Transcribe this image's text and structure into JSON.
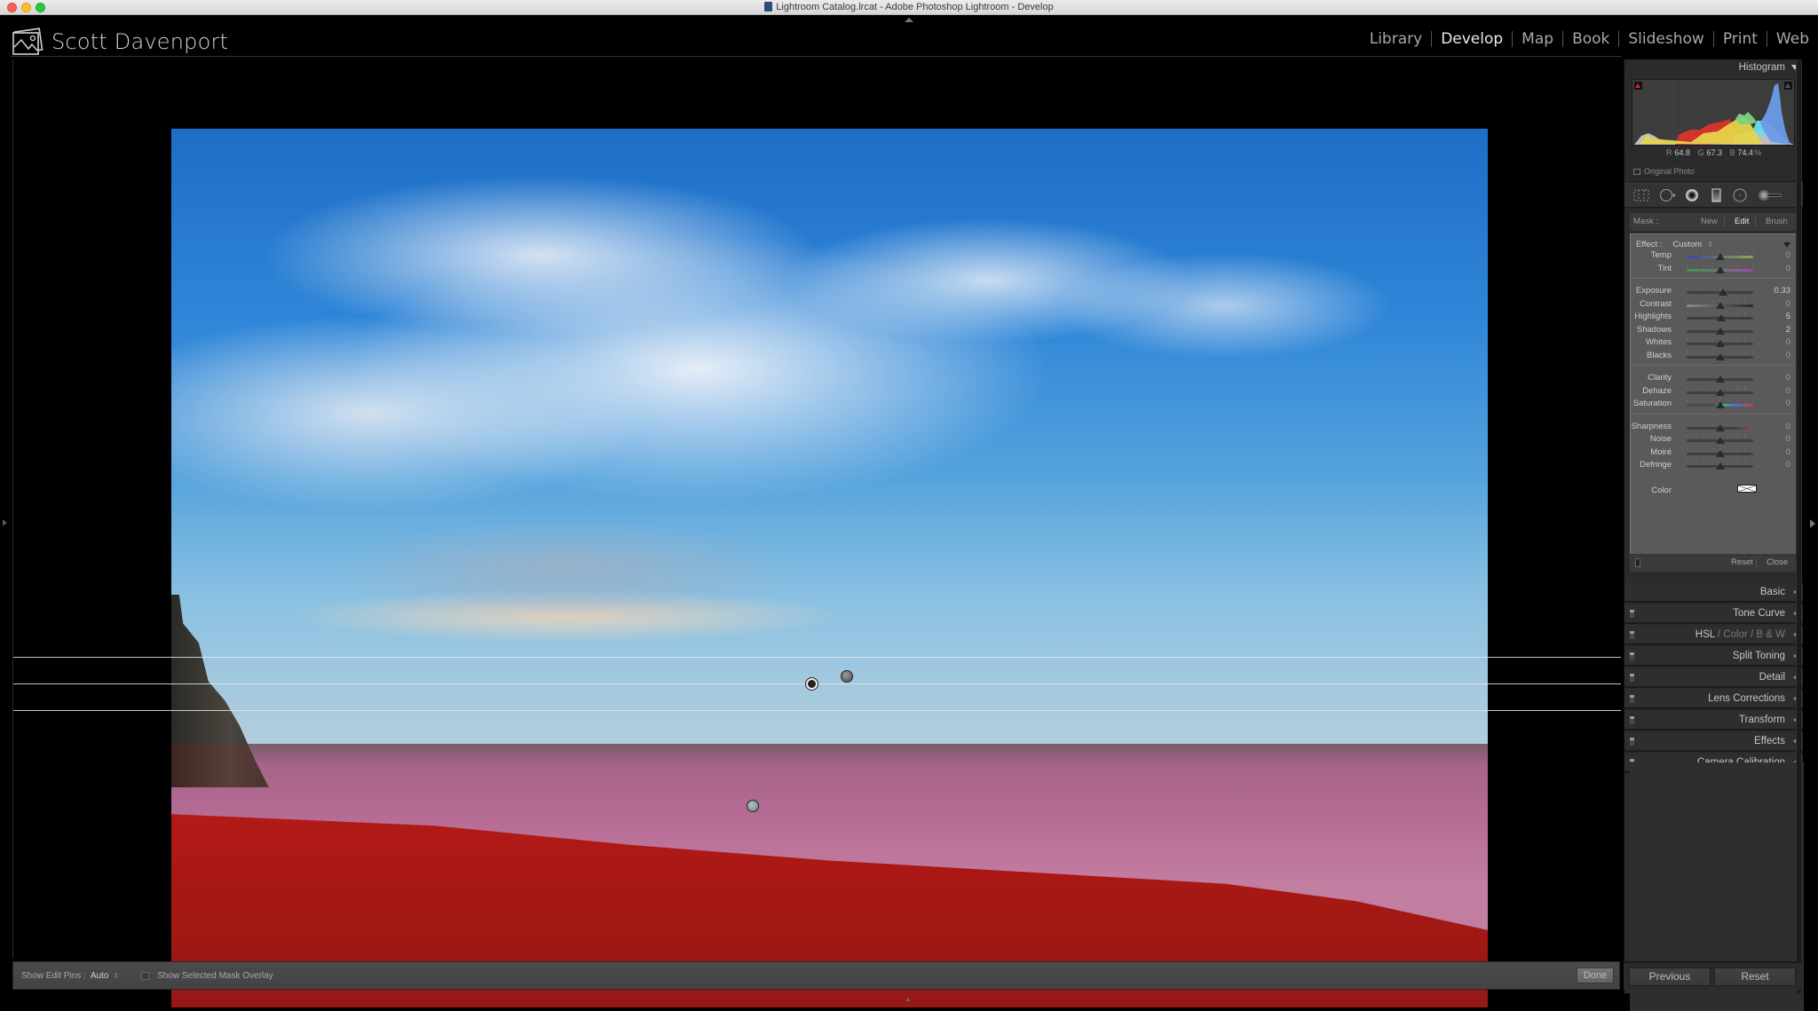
{
  "window": {
    "title": "Lightroom Catalog.lrcat - Adobe Photoshop Lightroom - Develop"
  },
  "identity": {
    "name": "Scott Davenport"
  },
  "modules": [
    {
      "label": "Library",
      "active": false
    },
    {
      "label": "Develop",
      "active": true
    },
    {
      "label": "Map",
      "active": false
    },
    {
      "label": "Book",
      "active": false
    },
    {
      "label": "Slideshow",
      "active": false
    },
    {
      "label": "Print",
      "active": false
    },
    {
      "label": "Web",
      "active": false
    }
  ],
  "histogram": {
    "header": "Histogram",
    "readout": {
      "r_label": "R",
      "r": "64.8",
      "g_label": "G",
      "g": "67.3",
      "b_label": "B",
      "b": "74.4",
      "unit": "%"
    },
    "original_photo_label": "Original Photo",
    "colors": {
      "red": "#d8342c",
      "yellow": "#e6d44a",
      "green": "#7ed27a",
      "cyan": "#6bdde6",
      "blue": "#6a9be8",
      "grey": "#c6c6c6"
    }
  },
  "tools": [
    {
      "icon": "crop-overlay-icon"
    },
    {
      "icon": "spot-removal-icon"
    },
    {
      "icon": "red-eye-icon"
    },
    {
      "icon": "graduated-filter-icon"
    },
    {
      "icon": "radial-filter-icon"
    },
    {
      "icon": "adjustment-brush-icon"
    }
  ],
  "mask": {
    "label": "Mask :",
    "options": [
      {
        "label": "New",
        "active": false
      },
      {
        "label": "Edit",
        "active": true
      },
      {
        "label": "Brush",
        "active": false
      }
    ]
  },
  "effect": {
    "label": "Effect :",
    "value": "Custom",
    "groups": [
      [
        {
          "label": "Temp",
          "value": "0",
          "position": 0.5
        },
        {
          "label": "Tint",
          "value": "0",
          "position": 0.5
        }
      ],
      [
        {
          "label": "Exposure",
          "value": "0.33",
          "position": 0.54
        },
        {
          "label": "Contrast",
          "value": "0",
          "position": 0.5
        },
        {
          "label": "Highlights",
          "value": "5",
          "position": 0.52
        },
        {
          "label": "Shadows",
          "value": "2",
          "position": 0.51
        },
        {
          "label": "Whites",
          "value": "0",
          "position": 0.5
        },
        {
          "label": "Blacks",
          "value": "0",
          "position": 0.5
        }
      ],
      [
        {
          "label": "Clarity",
          "value": "0",
          "position": 0.5
        },
        {
          "label": "Dehaze",
          "value": "0",
          "position": 0.5
        },
        {
          "label": "Saturation",
          "value": "0",
          "position": 0.5
        }
      ],
      [
        {
          "label": "Sharpness",
          "value": "0",
          "position": 0.5
        },
        {
          "label": "Noise",
          "value": "0",
          "position": 0.5
        },
        {
          "label": "Moiré",
          "value": "0",
          "position": 0.5
        },
        {
          "label": "Defringe",
          "value": "0",
          "position": 0.5
        }
      ]
    ],
    "color_label": "Color",
    "reset_label": "Reset",
    "close_label": "Close"
  },
  "sections": [
    {
      "label": "Basic",
      "has_switch": false
    },
    {
      "label": "Tone Curve",
      "has_switch": true
    },
    {
      "label": "HSL",
      "extra": [
        "Color",
        "B & W"
      ],
      "has_switch": true
    },
    {
      "label": "Split Toning",
      "has_switch": true
    },
    {
      "label": "Detail",
      "has_switch": true
    },
    {
      "label": "Lens Corrections",
      "has_switch": true
    },
    {
      "label": "Transform",
      "has_switch": true
    },
    {
      "label": "Effects",
      "has_switch": true
    },
    {
      "label": "Camera Calibration",
      "has_switch": true
    }
  ],
  "toolbar": {
    "edit_pins_label": "Show Edit Pins :",
    "edit_pins_value": "Auto",
    "mask_overlay_label": "Show Selected Mask Overlay",
    "mask_overlay_checked": false,
    "done_label": "Done"
  },
  "bottom_buttons": {
    "previous_label": "Previous",
    "reset_label": "Reset"
  }
}
